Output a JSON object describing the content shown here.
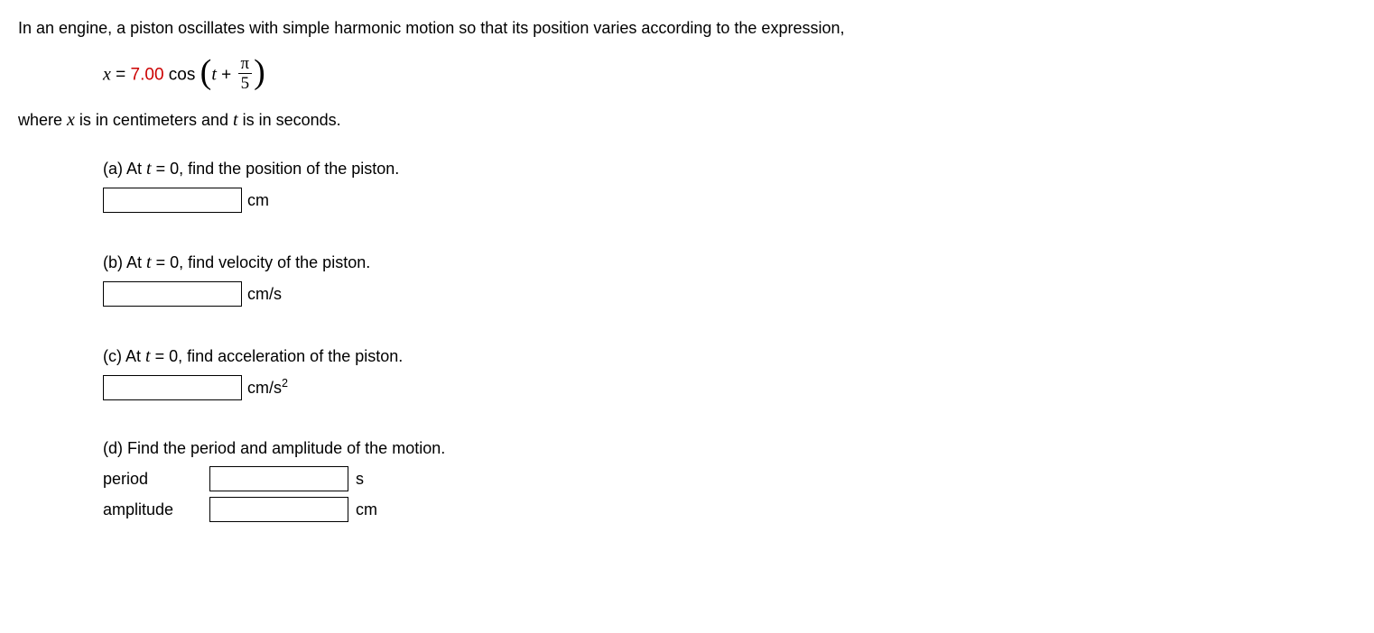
{
  "intro": "In an engine, a piston oscillates with simple harmonic motion so that its position varies according to the expression,",
  "equation": {
    "lhs_var": "x",
    "equals": " = ",
    "coefficient": "7.00",
    "func": " cos",
    "inner_var": "t",
    "plus": " + ",
    "frac_num": "π",
    "frac_den": "5"
  },
  "where_prefix": "where ",
  "where_x": "x",
  "where_mid": " is in centimeters and ",
  "where_t": "t",
  "where_suffix": " is in seconds.",
  "parts": {
    "a": {
      "label": "(a) At ",
      "var": "t",
      "eq": " = 0, find the position of the piston.",
      "unit": "cm"
    },
    "b": {
      "label": "(b) At ",
      "var": "t",
      "eq": " = 0, find velocity of the piston.",
      "unit": "cm/s"
    },
    "c": {
      "label": "(c) At ",
      "var": "t",
      "eq": " = 0, find acceleration of the piston.",
      "unit_pre": "cm/s",
      "unit_sup": "2"
    },
    "d": {
      "label": "(d) Find the period and amplitude of the motion.",
      "period_label": "period",
      "period_unit": "s",
      "amplitude_label": "amplitude",
      "amplitude_unit": "cm"
    }
  }
}
